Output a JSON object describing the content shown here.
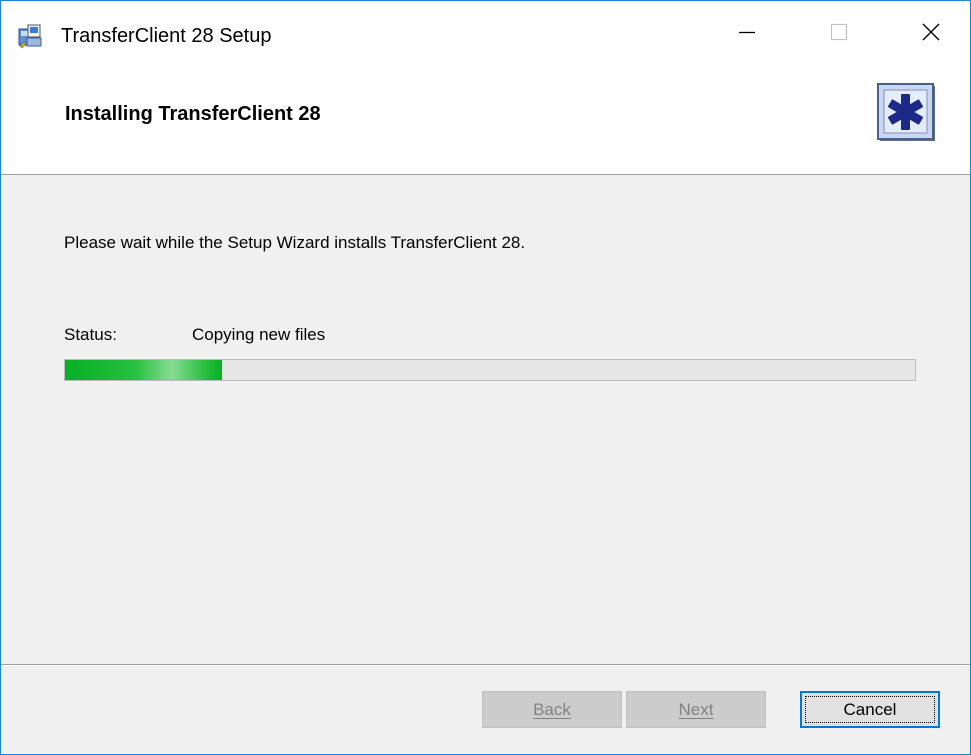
{
  "window": {
    "title": "TransferClient 28 Setup",
    "border_color": "#1883d7"
  },
  "titlebar": {
    "icons": [
      "installer-app-icon",
      "minimize-icon",
      "maximize-icon",
      "close-icon"
    ]
  },
  "header": {
    "title": "Installing TransferClient 28",
    "logo_icon": "setup-star-icon"
  },
  "main": {
    "intro": "Please wait while the Setup Wizard installs TransferClient 28.",
    "status_label": "Status:",
    "status_value": "Copying new files",
    "progress_fraction": 0.185,
    "progress_color": "#06b025"
  },
  "footer": {
    "back_label": "Back",
    "next_label": "Next",
    "cancel_label": "Cancel",
    "back_enabled": false,
    "next_enabled": false,
    "cancel_focused": true,
    "accent_color": "#0078d7"
  }
}
